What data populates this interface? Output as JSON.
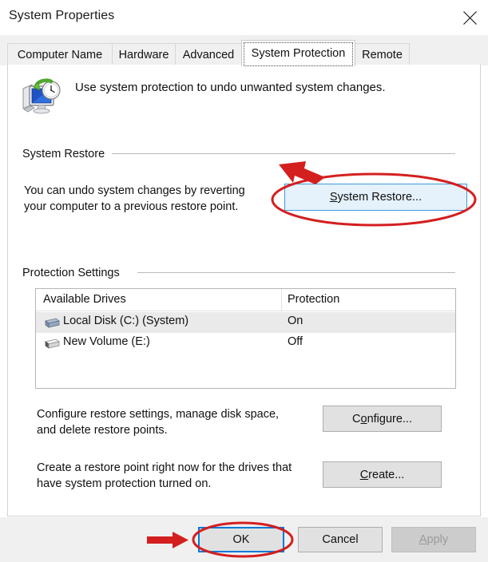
{
  "window": {
    "title": "System Properties",
    "close_icon": "close-icon"
  },
  "tabs": [
    {
      "label": "Computer Name",
      "selected": false
    },
    {
      "label": "Hardware",
      "selected": false
    },
    {
      "label": "Advanced",
      "selected": false
    },
    {
      "label": "System Protection",
      "selected": true
    },
    {
      "label": "Remote",
      "selected": false
    }
  ],
  "header": {
    "icon": "system-restore-computer-clock-icon",
    "text": "Use system protection to undo unwanted system changes."
  },
  "system_restore": {
    "group_label": "System Restore",
    "description_line1": "You can undo system changes by reverting",
    "description_line2": "your computer to a previous restore point.",
    "button_label": "System Restore...",
    "button_accel": "S",
    "button_state": "hovered"
  },
  "protection_settings": {
    "group_label": "Protection Settings",
    "columns": [
      "Available Drives",
      "Protection"
    ],
    "rows": [
      {
        "drive": "Local Disk (C:) (System)",
        "protection": "On",
        "selected": true,
        "icon": "hard-drive-icon-system"
      },
      {
        "drive": "New Volume (E:)",
        "protection": "Off",
        "selected": false,
        "icon": "hard-drive-icon"
      }
    ],
    "configure": {
      "description_line1": "Configure restore settings, manage disk space,",
      "description_line2": "and delete restore points.",
      "button_label": "Configure...",
      "button_accel": "o"
    },
    "create": {
      "description_line1": "Create a restore point right now for the drives that",
      "description_line2": "have system protection turned on.",
      "button_label": "Create...",
      "button_accel": "C"
    }
  },
  "footer": {
    "ok_label": "OK",
    "cancel_label": "Cancel",
    "apply_label": "Apply",
    "apply_accel": "A",
    "apply_disabled": true,
    "ok_focused": true
  },
  "annotations": {
    "color": "#d41f1f",
    "ellipse_system_restore": "red-ellipse-highlight",
    "arrow_system_restore": "red-arrow-pointer",
    "ellipse_ok": "red-ellipse-highlight",
    "arrow_ok": "red-arrow-pointer"
  },
  "colors": {
    "accent_focus": "#0078d7",
    "hover_blue": "#e5f1fb",
    "button_face": "#e1e1e1",
    "annotation_red": "#d41f1f"
  }
}
